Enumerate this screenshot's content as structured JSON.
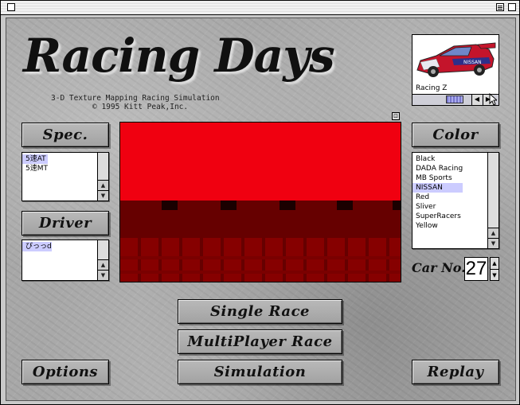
{
  "app": {
    "logo_text": "Racing Days",
    "subtitle": "3-D Texture Mapping Racing Simulation",
    "copyright": "© 1995 Kitt Peak,Inc."
  },
  "spec": {
    "button_label": "Spec.",
    "items": [
      "5速AT",
      "5速MT"
    ],
    "selected_index": 0
  },
  "driver": {
    "button_label": "Driver",
    "items": [
      "ぴっっd"
    ],
    "selected_index": 0
  },
  "color": {
    "button_label": "Color",
    "items": [
      "Black",
      "DADA Racing",
      "MB Sports",
      "NISSAN",
      "Red",
      "Sliver",
      "SuperRacers",
      "Yellow"
    ],
    "selected_index": 3
  },
  "car_preview": {
    "car_name": "Racing Z",
    "car_livery_text": "NISSAN"
  },
  "car_no": {
    "label": "Car No.",
    "value": "27"
  },
  "actions": {
    "single_race": "Single Race",
    "multiplayer_race": "MultiPlayer Race",
    "simulation": "Simulation",
    "options": "Options",
    "replay": "Replay"
  },
  "colors": {
    "track_sky": "#f00010",
    "track_ground": "#660000",
    "selection": "#ccccff",
    "car_body": "#c4142b"
  },
  "icons": {
    "scroll_up": "▲",
    "scroll_down": "▼",
    "scroll_left": "◀",
    "scroll_right": "▶"
  }
}
